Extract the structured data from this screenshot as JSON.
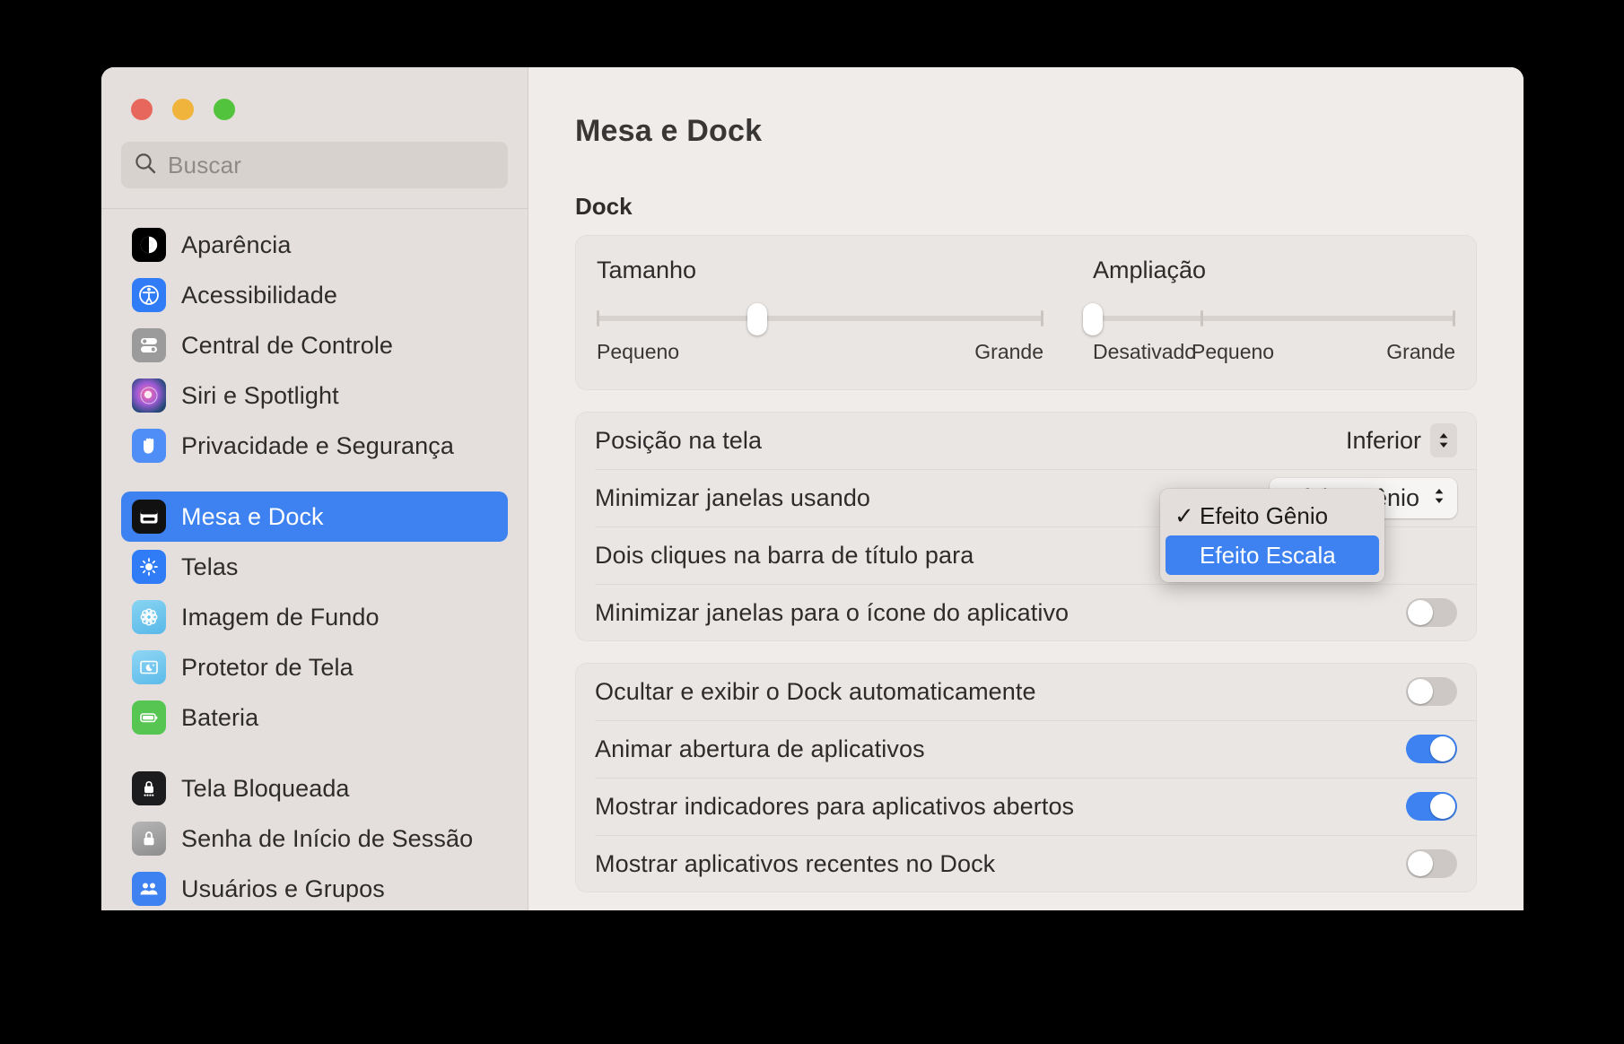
{
  "window": {
    "traffic_lights": [
      "close",
      "minimize",
      "zoom"
    ],
    "accent_color": "#3d82f0"
  },
  "search": {
    "placeholder": "Buscar",
    "value": "",
    "icon": "search-icon"
  },
  "sidebar": {
    "groups": [
      {
        "items": [
          {
            "label": "Aparência",
            "icon": "appearance-icon",
            "selected": false
          },
          {
            "label": "Acessibilidade",
            "icon": "accessibility-icon",
            "selected": false
          },
          {
            "label": "Central de Controle",
            "icon": "control-center-icon",
            "selected": false
          },
          {
            "label": "Siri e Spotlight",
            "icon": "siri-icon",
            "selected": false
          },
          {
            "label": "Privacidade e Segurança",
            "icon": "privacy-hand-icon",
            "selected": false
          }
        ]
      },
      {
        "items": [
          {
            "label": "Mesa e Dock",
            "icon": "desktop-dock-icon",
            "selected": true
          },
          {
            "label": "Telas",
            "icon": "displays-brightness-icon",
            "selected": false
          },
          {
            "label": "Imagem de Fundo",
            "icon": "wallpaper-flower-icon",
            "selected": false
          },
          {
            "label": "Protetor de Tela",
            "icon": "screensaver-moon-icon",
            "selected": false
          },
          {
            "label": "Bateria",
            "icon": "battery-icon",
            "selected": false
          }
        ]
      },
      {
        "items": [
          {
            "label": "Tela Bloqueada",
            "icon": "lock-screen-icon",
            "selected": false
          },
          {
            "label": "Senha de Início de Sessão",
            "icon": "login-password-lock-icon",
            "selected": false
          },
          {
            "label": "Usuários e Grupos",
            "icon": "users-groups-icon",
            "selected": false
          }
        ]
      }
    ]
  },
  "main": {
    "title": "Mesa e Dock",
    "section_dock": "Dock",
    "sliders": {
      "size": {
        "label": "Tamanho",
        "min_label": "Pequeno",
        "max_label": "Grande",
        "value_percent": 36
      },
      "magnification": {
        "label": "Ampliação",
        "off_label": "Desativado",
        "min_label": "Pequeno",
        "max_label": "Grande",
        "value_percent": 0
      }
    },
    "rows": [
      {
        "label": "Posição na tela",
        "control": "popup-plain",
        "value": "Inferior"
      },
      {
        "label": "Minimizar janelas usando",
        "control": "popup-boxed",
        "value": "Efeito Gênio"
      },
      {
        "label": "Dois cliques na barra de título para",
        "control": "none",
        "value": ""
      },
      {
        "label": "Minimizar janelas para o ícone do aplicativo",
        "control": "toggle",
        "value": "off"
      }
    ],
    "rows2": [
      {
        "label": "Ocultar e exibir o Dock automaticamente",
        "control": "toggle",
        "value": "off"
      },
      {
        "label": "Animar abertura de aplicativos",
        "control": "toggle",
        "value": "on"
      },
      {
        "label": "Mostrar indicadores para aplicativos abertos",
        "control": "toggle",
        "value": "on"
      },
      {
        "label": "Mostrar aplicativos recentes no Dock",
        "control": "toggle",
        "value": "off"
      }
    ],
    "dropdown_menu": {
      "open": true,
      "items": [
        {
          "label": "Efeito Gênio",
          "checked": true,
          "highlighted": false
        },
        {
          "label": "Efeito Escala",
          "checked": false,
          "highlighted": true
        }
      ]
    }
  }
}
